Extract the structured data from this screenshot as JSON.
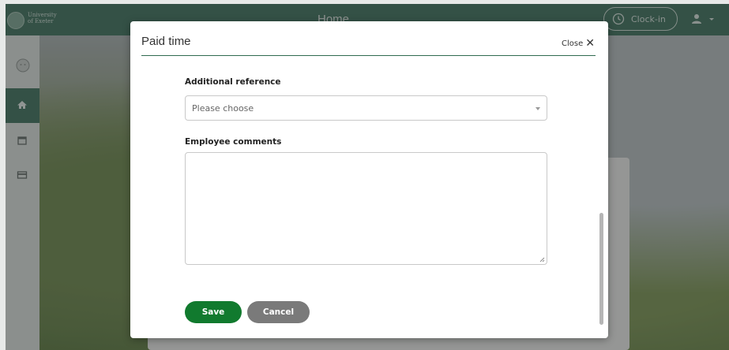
{
  "header": {
    "brand_name": "University\nof Exeter",
    "page_title": "Home",
    "clock_in_label": "Clock-in"
  },
  "modal": {
    "title": "Paid time",
    "close_label": "Close",
    "additional_reference": {
      "label": "Additional reference",
      "placeholder": "Please choose"
    },
    "employee_comments": {
      "label": "Employee comments",
      "value": ""
    },
    "save_label": "Save",
    "cancel_label": "Cancel"
  },
  "icons": {
    "clock": "clock-icon",
    "user": "user-icon",
    "close": "close-icon",
    "home": "home-icon",
    "calendar": "calendar-icon",
    "card": "card-icon",
    "avatar": "avatar-icon"
  },
  "colors": {
    "brand_green": "#3e7460",
    "save_green": "#117a2e",
    "cancel_gray": "#7a7a7a"
  }
}
